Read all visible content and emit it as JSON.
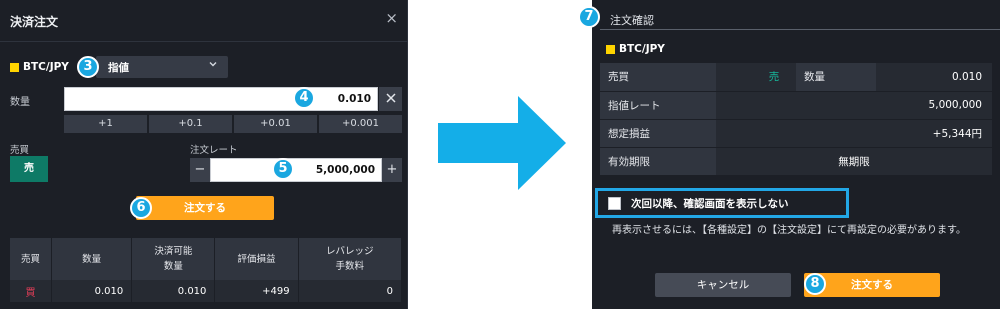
{
  "left_panel": {
    "title": "決済注文",
    "close_glyph": "×",
    "symbol": "BTC/JPY",
    "order_type": "指値",
    "quantity_label": "数量",
    "quantity_value": "0.010",
    "quantity_steps": [
      "+1",
      "+0.1",
      "+0.01",
      "+0.001"
    ],
    "side_label": "売買",
    "side_value": "売",
    "rate_label": "注文レート",
    "rate_value": "5,000,000",
    "minus_glyph": "−",
    "plus_glyph": "+",
    "order_button": "注文する",
    "positions_table": {
      "headers": [
        [
          "売買"
        ],
        [
          "数量"
        ],
        [
          "決済可能",
          "数量"
        ],
        [
          "評価損益"
        ],
        [
          "レバレッジ",
          "手数料"
        ]
      ],
      "rows": [
        [
          "買",
          "0.010",
          "0.010",
          "+499",
          "0"
        ]
      ]
    }
  },
  "right_panel": {
    "title": "注文確認",
    "symbol": "BTC/JPY",
    "rows": {
      "side_key": "売買",
      "side_value": "売",
      "qty_key": "数量",
      "qty_value": "0.010",
      "limit_key": "指値レート",
      "limit_value": "5,000,000",
      "pnl_key": "想定損益",
      "pnl_value": "+5,344円",
      "expiry_key": "有効期限",
      "expiry_value": "無期限"
    },
    "checkbox_label": "次回以降、確認画面を表示しない",
    "note": "再表示させるには、【各種設定】の【注文設定】にて再設定の必要があります。",
    "cancel_button": "キャンセル",
    "order_button": "注文する"
  },
  "markers": [
    "3",
    "4",
    "5",
    "6",
    "7",
    "8"
  ],
  "colors": {
    "panel_bg": "#1c1f26",
    "order_orange": "#ffa41b",
    "sell_green": "#0e7a66",
    "buy_red": "#e33d58",
    "marker_blue": "#1aa7e0",
    "arrow_blue": "#14aee8",
    "symbol_yellow": "#ffd400"
  }
}
